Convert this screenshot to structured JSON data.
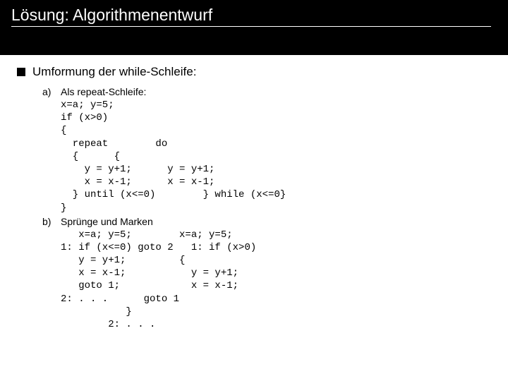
{
  "header": {
    "title": "Lösung: Algorithmenentwurf"
  },
  "main": {
    "bullet": "Umformung der while-Schleife:",
    "items": [
      {
        "label": "a)",
        "title": "Als repeat-Schleife:",
        "code": "x=a; y=5;\nif (x>0)\n{\n  repeat        do\n  {      {\n    y = y+1;      y = y+1;\n    x = x-1;      x = x-1;\n  } until (x<=0)        } while (x<=0}\n}"
      },
      {
        "label": "b)",
        "title": "Sprünge und Marken",
        "code": "   x=a; y=5;        x=a; y=5;\n1: if (x<=0) goto 2   1: if (x>0)\n   y = y+1;         {\n   x = x-1;           y = y+1;\n   goto 1;            x = x-1;\n2: . . .      goto 1\n           }\n        2: . . ."
      }
    ]
  }
}
